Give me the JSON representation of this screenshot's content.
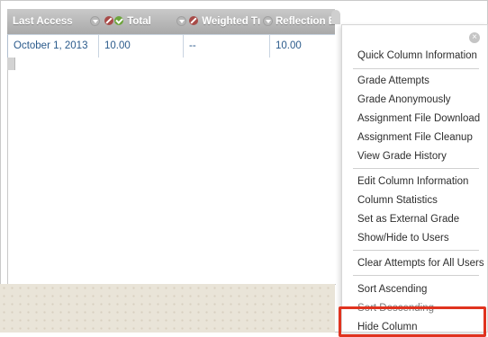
{
  "grid": {
    "headers": [
      {
        "label": "Last Access"
      },
      {
        "label": "Total"
      },
      {
        "label": "Weighted Tı"
      },
      {
        "label": "Reflection Ess:"
      }
    ],
    "row": [
      "October 1, 2013",
      "10.00",
      "--",
      "10.00"
    ]
  },
  "menu": {
    "groups": [
      [
        "Quick Column Information"
      ],
      [
        "Grade Attempts",
        "Grade Anonymously",
        "Assignment File Download",
        "Assignment File Cleanup",
        "View Grade History"
      ],
      [
        "Edit Column Information",
        "Column Statistics",
        "Set as External Grade",
        "Show/Hide to Users"
      ],
      [
        "Clear Attempts for All Users"
      ],
      [
        "Sort Ascending",
        "Sort Descending",
        "Hide Column"
      ]
    ],
    "close_icon": "x-circle-icon",
    "highlight_color": "#e0331f"
  }
}
